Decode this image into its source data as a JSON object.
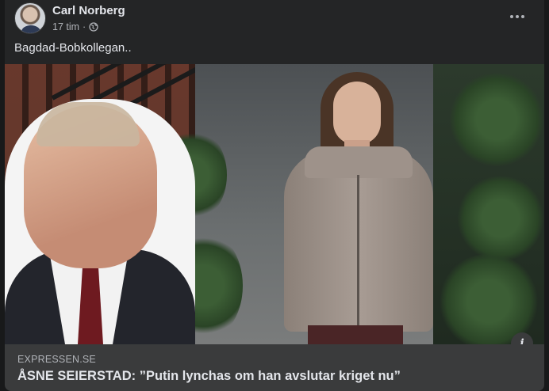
{
  "post": {
    "author": "Carl Norberg",
    "time": "17 tim",
    "separator": "·",
    "audience_icon": "globe-icon",
    "more_icon": "more-options-icon",
    "text": "Bagdad-Bobkollegan.."
  },
  "link_preview": {
    "domain": "EXPRESSEN.SE",
    "title": "ÅSNE SEIERSTAD: ”Putin lynchas om han avslutar kriget nu”",
    "info_icon": "info-icon",
    "info_glyph": "i"
  },
  "colors": {
    "card": "#242526",
    "link_box": "#3a3b3c",
    "primary_text": "#e4e6eb",
    "secondary_text": "#b0b3b8"
  }
}
